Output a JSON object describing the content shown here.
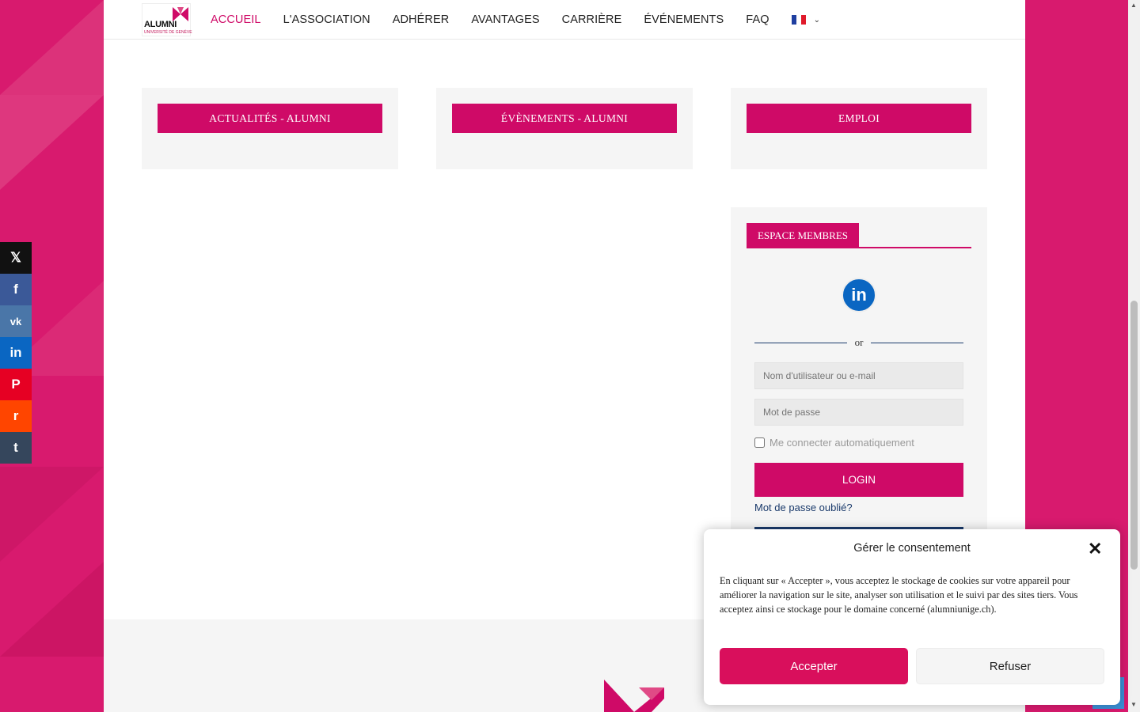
{
  "nav": {
    "logo_text": "ALUMNI",
    "logo_sub": "UNIVERSITÉ DE GENÈVE",
    "items": [
      {
        "label": "ACCUEIL",
        "active": true
      },
      {
        "label": "L'ASSOCIATION"
      },
      {
        "label": "ADHÉRER"
      },
      {
        "label": "AVANTAGES"
      },
      {
        "label": "CARRIÈRE"
      },
      {
        "label": "ÉVÉNEMENTS"
      },
      {
        "label": "FAQ"
      }
    ],
    "language_flag": "fr-flag-icon",
    "language_chevron": "⌄"
  },
  "cards": [
    {
      "label": "ACTUALITÉS - ALUMNI"
    },
    {
      "label": "ÉVÈNEMENTS - ALUMNI"
    },
    {
      "label": "EMPLOI"
    }
  ],
  "members": {
    "tab_label": "ESPACE MEMBRES",
    "linkedin_label": "in",
    "or_label": "or",
    "username_placeholder": "Nom d'utilisateur ou e-mail",
    "password_placeholder": "Mot de passe",
    "remember_label": "Me connecter automatiquement",
    "login_label": "LOGIN",
    "forgot_label": "Mot de passe oublié?"
  },
  "social": [
    "𝕏",
    "f",
    "vk",
    "in",
    "P",
    "r",
    "t"
  ],
  "consent": {
    "title": "Gérer le consentement",
    "close": "✕",
    "text": "En cliquant sur « Accepter », vous acceptez le stockage de cookies sur votre appareil pour améliorer la navigation sur le site, analyser son utilisation et le suivi par des sites tiers. Vous acceptez ainsi ce stockage pour le domaine concerné (alumniunige.ch).",
    "accept_label": "Accepter",
    "refuse_label": "Refuser"
  },
  "colors": {
    "brand": "#cf0a67",
    "navy": "#1a3a6b"
  }
}
